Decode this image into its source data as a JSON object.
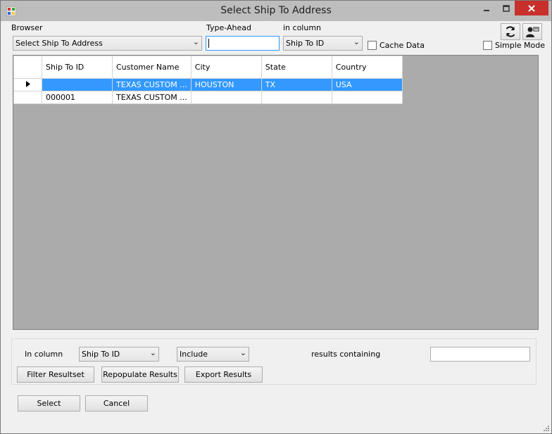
{
  "window": {
    "title": "Select Ship To Address"
  },
  "toolbar": {
    "browser_label": "Browser",
    "browser_value": "Select Ship To Address",
    "typeahead_label": "Type-Ahead",
    "typeahead_value": "",
    "in_column_label": "in column",
    "in_column_value": "Ship To ID",
    "cache_data_label": "Cache Data",
    "simple_mode_label": "Simple Mode"
  },
  "grid": {
    "columns": [
      "Ship To ID",
      "Customer Name",
      "City",
      "State",
      "Country"
    ],
    "rows": [
      {
        "ship_to_id": "",
        "customer_name": "TEXAS CUSTOM ...",
        "city": "HOUSTON",
        "state": "TX",
        "country": "USA",
        "selected": true
      },
      {
        "ship_to_id": "000001",
        "customer_name": "TEXAS CUSTOM ...",
        "city": "",
        "state": "",
        "country": "",
        "selected": false
      }
    ]
  },
  "filter": {
    "in_column_label": "In column",
    "column_value": "Ship To ID",
    "mode_value": "Include",
    "results_containing_label": "results containing",
    "search_value": "",
    "filter_button": "Filter Resultset",
    "repopulate_button": "Repopulate Results",
    "export_button": "Export Results"
  },
  "footer": {
    "select_button": "Select",
    "cancel_button": "Cancel"
  },
  "colors": {
    "selection": "#3399ff",
    "close_button": "#c7302b",
    "grid_background": "#ababab"
  }
}
